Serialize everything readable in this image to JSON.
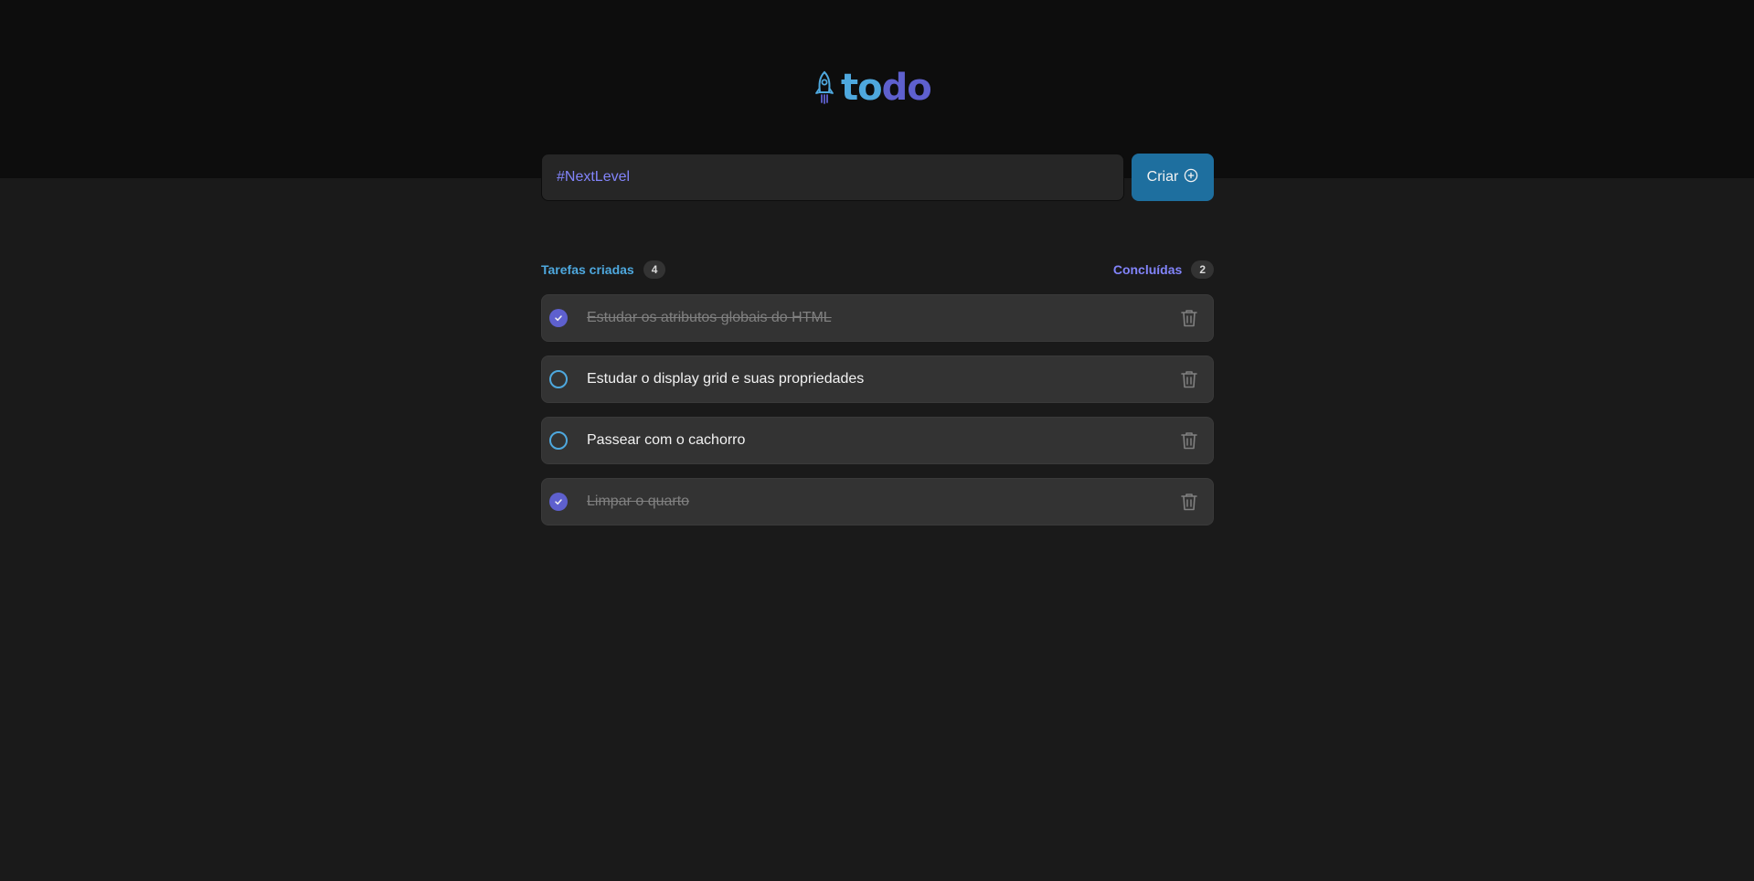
{
  "logo": {
    "part1": "to",
    "part2": "do",
    "icon": "rocket-icon"
  },
  "new_task": {
    "value": "#NextLevel",
    "create_label": "Criar",
    "create_icon": "plus-circle-icon"
  },
  "counters": {
    "created_label": "Tarefas criadas",
    "created_count": "4",
    "done_label": "Concluídas",
    "done_count": "2"
  },
  "tasks": [
    {
      "text": "Estudar os atributos globais do HTML",
      "done": true
    },
    {
      "text": "Estudar o display grid e suas propriedades",
      "done": false
    },
    {
      "text": "Passear com o cachorro",
      "done": false
    },
    {
      "text": "Limpar o quarto",
      "done": true
    }
  ],
  "colors": {
    "blue": "#4ea8de",
    "purple": "#5e60ce",
    "purple_light": "#8284fa",
    "blue_dark": "#1e6f9f"
  }
}
